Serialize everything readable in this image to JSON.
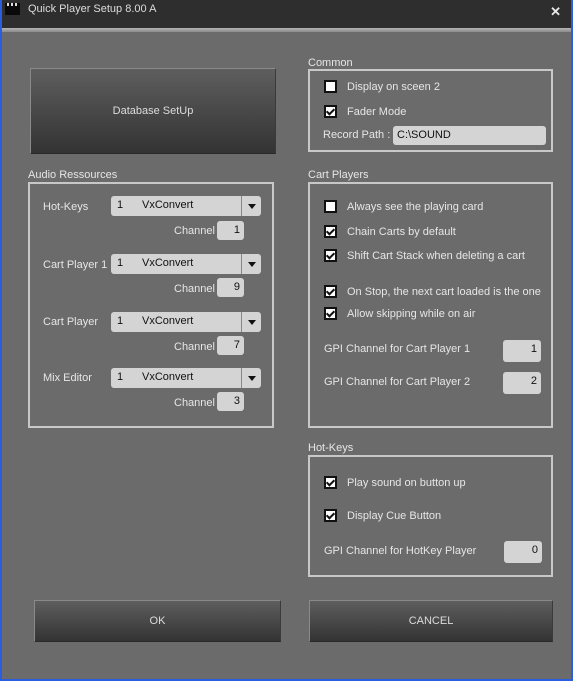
{
  "window": {
    "title": "Quick Player Setup 8.00 A",
    "icon": "clapperboard-icon",
    "close_icon": "close-icon"
  },
  "database_button": "Database SetUp",
  "audio": {
    "title": "Audio Ressources",
    "channel_label": "Channel",
    "rows": [
      {
        "label": "Hot-Keys",
        "device_num": "1",
        "device_name": "VxConvert",
        "channel": "1"
      },
      {
        "label": "Cart Player 1",
        "device_num": "1",
        "device_name": "VxConvert",
        "channel": "9"
      },
      {
        "label": "Cart Player",
        "device_num": "1",
        "device_name": "VxConvert",
        "channel": "7"
      },
      {
        "label": "Mix Editor",
        "device_num": "1",
        "device_name": "VxConvert",
        "channel": "3"
      }
    ]
  },
  "common": {
    "title": "Common",
    "display_screen2": {
      "label": "Display on sceen 2",
      "checked": false
    },
    "fader_mode": {
      "label": "Fader Mode",
      "checked": true
    },
    "record_path_label": "Record Path :",
    "record_path_value": "C:\\SOUND"
  },
  "cart_players": {
    "title": "Cart Players",
    "options": [
      {
        "label": "Always see the playing card",
        "checked": false
      },
      {
        "label": "Chain Carts by default",
        "checked": true
      },
      {
        "label": "Shift Cart Stack when deleting a cart",
        "checked": true
      },
      {
        "label": "On Stop, the next cart loaded is the one",
        "checked": true
      },
      {
        "label": "Allow skipping while on air",
        "checked": true
      }
    ],
    "gpi1_label": "GPI Channel for Cart Player 1",
    "gpi1_value": "1",
    "gpi2_label": "GPI Channel for Cart Player 2",
    "gpi2_value": "2"
  },
  "hotkeys": {
    "title": "Hot-Keys",
    "options": [
      {
        "label": "Play sound on button up",
        "checked": true
      },
      {
        "label": "Display Cue Button",
        "checked": true
      }
    ],
    "gpi_label": "GPI Channel for HotKey Player",
    "gpi_value": "0"
  },
  "footer": {
    "ok": "OK",
    "cancel": "CANCEL"
  }
}
